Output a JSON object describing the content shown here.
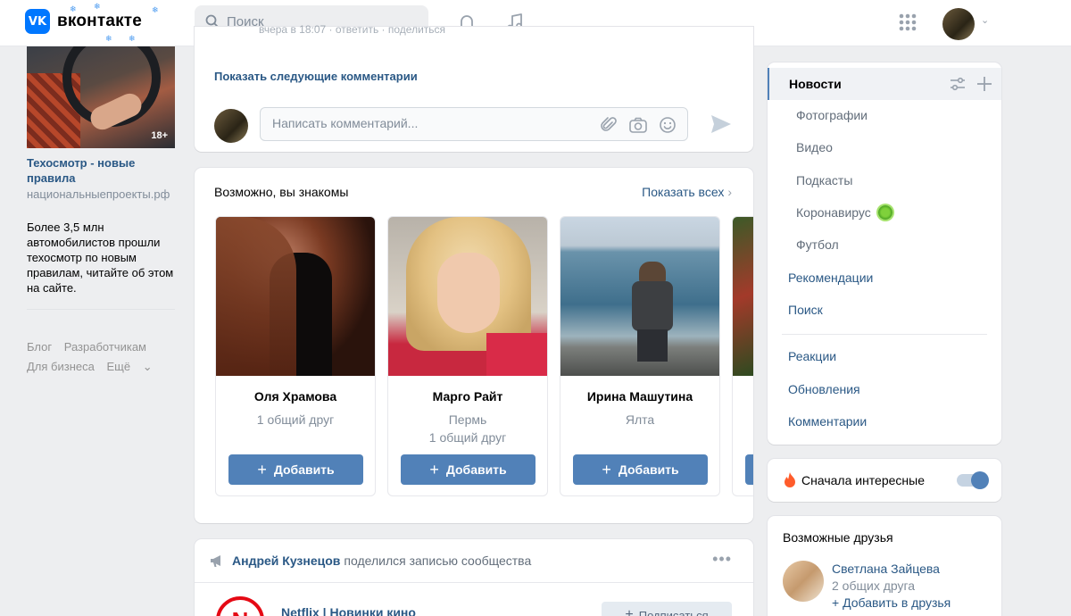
{
  "header": {
    "logo_mark": "VK",
    "logo_text": "вконтакте",
    "search_placeholder": "Поиск",
    "icons": [
      "search-icon",
      "bell-icon",
      "music-icon",
      "apps-grid-icon",
      "chevron-down-icon"
    ]
  },
  "left": {
    "ad": {
      "age_badge": "18+",
      "title": "Техосмотр - новые правила",
      "domain": "национальныепроекты.рф",
      "description": "Более 3,5 млн автомобилистов прошли техосмотр по новым правилам, читайте об этом на сайте."
    },
    "footer_links": [
      "Блог",
      "Разработчикам",
      "Для бизнеса",
      "Ещё"
    ]
  },
  "comments": {
    "faded_meta": "вчера в 18:07 · ответить · поделиться",
    "show_more": "Показать следующие комментарии",
    "input_placeholder": "Написать комментарий..."
  },
  "pymk": {
    "title": "Возможно, вы знакомы",
    "show_all": "Показать всех",
    "add_label": "Добавить",
    "people": [
      {
        "name": "Оля Храмова",
        "line1": "1 общий друг",
        "line2": ""
      },
      {
        "name": "Марго Райт",
        "line1": "Пермь",
        "line2": "1 общий друг"
      },
      {
        "name": "Ирина Машутина",
        "line1": "Ялта",
        "line2": ""
      }
    ]
  },
  "post": {
    "author": "Андрей Кузнецов",
    "action": "поделился записью сообщества",
    "community": "Netflix | Новинки кино",
    "community_logo": "N",
    "subscribe": "Подписаться"
  },
  "right_nav": {
    "items": [
      {
        "label": "Новости",
        "type": "active"
      },
      {
        "label": "Фотографии",
        "type": "sub"
      },
      {
        "label": "Видео",
        "type": "sub"
      },
      {
        "label": "Подкасты",
        "type": "sub"
      },
      {
        "label": "Коронавирус",
        "type": "sub"
      },
      {
        "label": "Футбол",
        "type": "sub"
      },
      {
        "label": "Рекомендации",
        "type": "main"
      },
      {
        "label": "Поиск",
        "type": "main"
      },
      {
        "label": "Реакции",
        "type": "main"
      },
      {
        "label": "Обновления",
        "type": "main"
      },
      {
        "label": "Комментарии",
        "type": "main"
      }
    ]
  },
  "interesting_toggle": {
    "label": "Сначала интересные",
    "on": true
  },
  "friends": {
    "title": "Возможные друзья",
    "name": "Светлана Зайцева",
    "mutual": "2 общих друга",
    "add": "Добавить в друзья"
  },
  "colors": {
    "accent": "#5181b8",
    "link": "#2a5885",
    "brand": "#0077ff"
  }
}
